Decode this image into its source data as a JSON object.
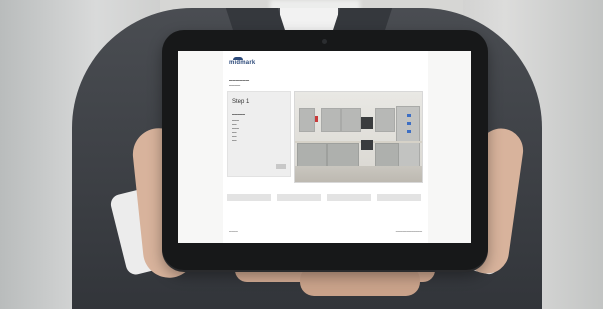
{
  "colors": {
    "suit": "#3c3f44",
    "tablet_bezel": "#171819",
    "brand_blue": "#2d4a7a",
    "cabinet_gray": "#b7b8b6",
    "bin_blue": "#3d6fc4",
    "bin_red": "#c93a3a"
  },
  "screen": {
    "logo": "midmark",
    "step_title": "Step 1"
  },
  "icons": {
    "logo_mark": "midmark-logo-arc-icon",
    "camera": "front-camera-dot"
  }
}
